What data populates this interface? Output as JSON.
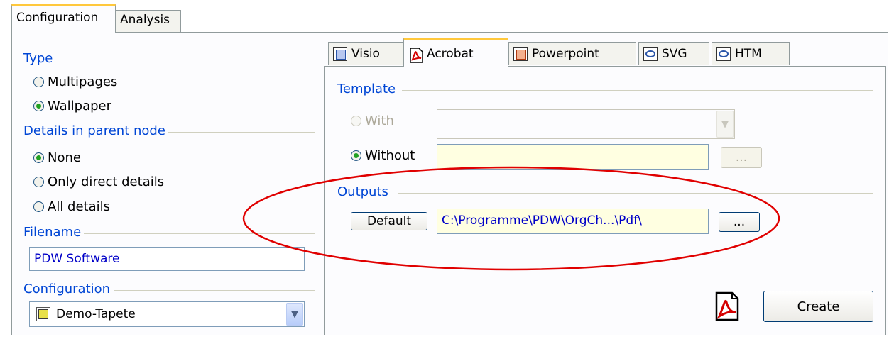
{
  "top_tabs": [
    {
      "label": "Configuration",
      "active": true
    },
    {
      "label": "Analysis",
      "active": false
    }
  ],
  "left": {
    "type": {
      "label": "Type",
      "options": [
        {
          "label": "Multipages",
          "checked": false
        },
        {
          "label": "Wallpaper",
          "checked": true
        }
      ]
    },
    "details": {
      "label": "Details in parent node",
      "options": [
        {
          "label": "None",
          "checked": true
        },
        {
          "label": "Only direct details",
          "checked": false
        },
        {
          "label": "All details",
          "checked": false
        }
      ]
    },
    "filename": {
      "label": "Filename",
      "value": "PDW Software"
    },
    "configuration": {
      "label": "Configuration",
      "value": "Demo-Tapete"
    }
  },
  "right": {
    "tabs": [
      {
        "label": "Visio",
        "icon": "visio-icon",
        "active": false
      },
      {
        "label": "Acrobat",
        "icon": "acrobat-icon",
        "active": true
      },
      {
        "label": "Powerpoint",
        "icon": "powerpoint-icon",
        "active": false
      },
      {
        "label": "SVG",
        "icon": "web-icon",
        "active": false
      },
      {
        "label": "HTM",
        "icon": "web-icon",
        "active": false
      }
    ],
    "template": {
      "label": "Template",
      "with_label": "With",
      "without_label": "Without",
      "browse_label": "..."
    },
    "outputs": {
      "label": "Outputs",
      "default_label": "Default",
      "path": "C:\\Programme\\PDW\\OrgCh...\\Pdf\\",
      "browse_label": "..."
    },
    "create_label": "Create"
  },
  "colors": {
    "group_label": "#0046d5",
    "annotation_ellipse": "#e00000",
    "tab_highlight": "#ffc83c"
  }
}
